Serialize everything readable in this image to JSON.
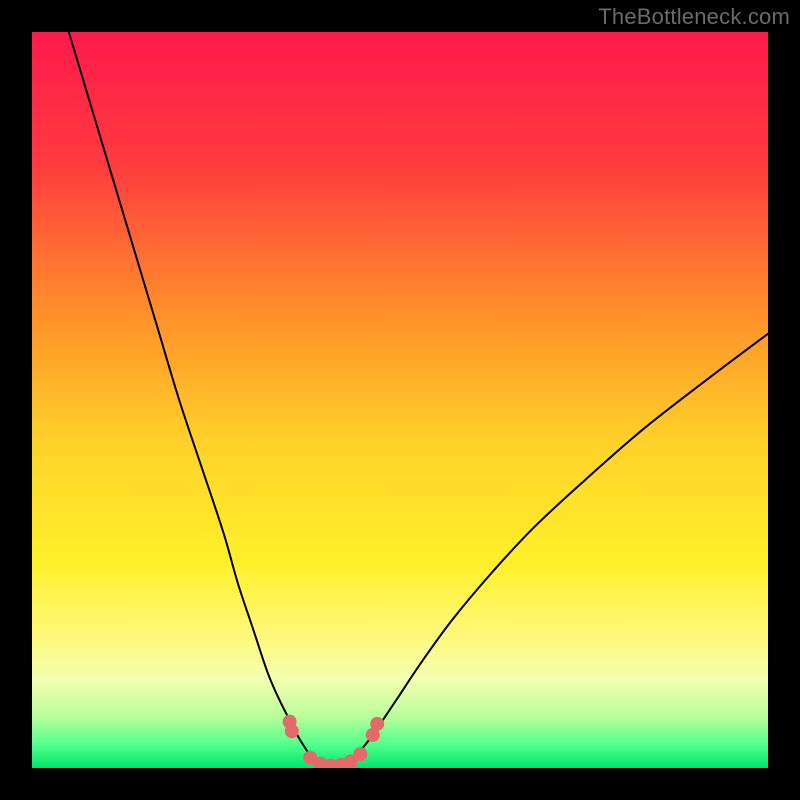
{
  "watermark": "TheBottleneck.com",
  "chart_data": {
    "type": "line",
    "title": "",
    "xlabel": "",
    "ylabel": "",
    "xlim": [
      0,
      100
    ],
    "ylim": [
      0,
      100
    ],
    "gradient_stops": [
      {
        "offset": 0.0,
        "color": "#ff1a4d"
      },
      {
        "offset": 0.18,
        "color": "#ff3b3f"
      },
      {
        "offset": 0.38,
        "color": "#ff8f2a"
      },
      {
        "offset": 0.56,
        "color": "#ffd22a"
      },
      {
        "offset": 0.72,
        "color": "#fff02a"
      },
      {
        "offset": 0.82,
        "color": "#fff87a"
      },
      {
        "offset": 0.88,
        "color": "#f3ffb0"
      },
      {
        "offset": 0.93,
        "color": "#b8ff9a"
      },
      {
        "offset": 0.97,
        "color": "#4dff8b"
      },
      {
        "offset": 1.0,
        "color": "#00e56a"
      }
    ],
    "series": [
      {
        "name": "left-curve",
        "x": [
          5,
          8,
          11,
          14,
          17,
          20,
          23,
          26,
          28,
          30,
          32,
          33.5,
          35,
          36.2,
          37.2,
          38
        ],
        "y": [
          100,
          90,
          80,
          70,
          60,
          50,
          41,
          32,
          25,
          19,
          13,
          9.5,
          6.5,
          4.2,
          2.6,
          1.4
        ]
      },
      {
        "name": "right-curve",
        "x": [
          44,
          45,
          46.3,
          48,
          50,
          53,
          57,
          62,
          68,
          75,
          83,
          92,
          100
        ],
        "y": [
          1.5,
          2.8,
          4.5,
          7,
          10,
          14.5,
          20,
          26,
          32.5,
          39,
          46,
          53,
          59
        ]
      },
      {
        "name": "trough",
        "x": [
          38,
          38.8,
          39.8,
          41,
          42.2,
          43.2,
          44
        ],
        "y": [
          1.4,
          0.6,
          0.25,
          0.2,
          0.28,
          0.7,
          1.5
        ]
      }
    ],
    "markers": {
      "name": "trough-markers",
      "color": "#e36a6a",
      "r": 7,
      "points": [
        {
          "x": 35.0,
          "y": 6.3
        },
        {
          "x": 35.3,
          "y": 5.0
        },
        {
          "x": 37.8,
          "y": 1.4
        },
        {
          "x": 39.2,
          "y": 0.6
        },
        {
          "x": 40.6,
          "y": 0.35
        },
        {
          "x": 42.0,
          "y": 0.45
        },
        {
          "x": 43.3,
          "y": 0.9
        },
        {
          "x": 44.6,
          "y": 1.9
        },
        {
          "x": 46.3,
          "y": 4.5
        },
        {
          "x": 46.9,
          "y": 6.0
        }
      ]
    }
  }
}
